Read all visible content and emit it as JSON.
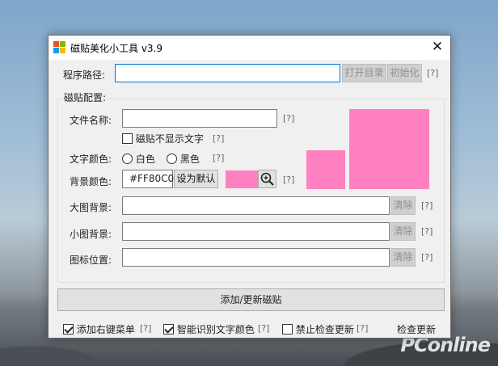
{
  "window": {
    "title": "磁贴美化小工具 v3.9",
    "close_glyph": "✕"
  },
  "program_path": {
    "label": "程序路径:",
    "value": "",
    "open_dir_label": "打开目录",
    "init_label": "初始化",
    "help": "[?]"
  },
  "tile_config": {
    "group_label": "磁贴配置:",
    "file_name": {
      "label": "文件名称:",
      "value": "",
      "help": "[?]"
    },
    "hide_text": {
      "label": "磁贴不显示文字",
      "checked": false,
      "help": "[?]"
    },
    "text_color": {
      "label": "文字颜色:",
      "options": [
        {
          "label": "白色",
          "selected": false
        },
        {
          "label": "黑色",
          "selected": false
        }
      ],
      "help": "[?]"
    },
    "bg_color": {
      "label": "背景颜色:",
      "value": "#FF80C0",
      "set_default_label": "设为默认",
      "help": "[?]"
    },
    "large_bg": {
      "label": "大图背景:",
      "value": "",
      "clear_label": "清除",
      "help": "[?]"
    },
    "small_bg": {
      "label": "小图背景:",
      "value": "",
      "clear_label": "清除",
      "help": "[?]"
    },
    "icon_pos": {
      "label": "图标位置:",
      "value": "",
      "clear_label": "清除",
      "help": "[?]"
    }
  },
  "add_update_label": "添加/更新磁贴",
  "status_bar": {
    "context_menu": {
      "label": "添加右键菜单",
      "checked": true,
      "help": "[?]"
    },
    "smart_color": {
      "label": "智能识别文字颜色",
      "checked": true,
      "help": "[?]"
    },
    "disable_update": {
      "label": "禁止检查更新",
      "checked": false,
      "help": "[?]"
    },
    "check_update_label": "检查更新"
  },
  "watermark": "PConline",
  "colors": {
    "tile_preview": "#ff80c0",
    "focus_border": "#0078d7",
    "logo": [
      "#f25022",
      "#7fba00",
      "#00a4ef",
      "#ffb900"
    ]
  },
  "icons": {
    "app": "windows-logo-icon",
    "close": "close-icon",
    "zoom": "magnifier-plus-icon"
  }
}
